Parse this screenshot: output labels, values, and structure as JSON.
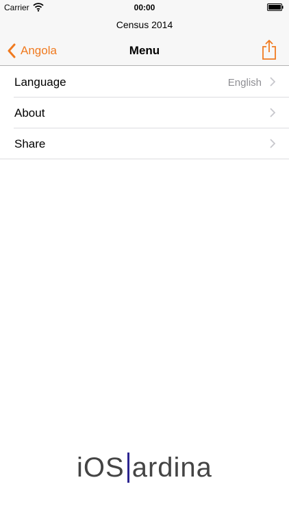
{
  "status_bar": {
    "carrier": "Carrier",
    "time": "00:00"
  },
  "header": {
    "subtitle": "Census 2014",
    "back_label": "Angola",
    "title": "Menu"
  },
  "menu": {
    "items": [
      {
        "label": "Language",
        "value": "English"
      },
      {
        "label": "About"
      },
      {
        "label": "Share"
      }
    ]
  },
  "logo": {
    "left": "iOS",
    "right": "ardina"
  },
  "colors": {
    "accent": "#f07a1f",
    "logo_bar": "#2b2490"
  }
}
